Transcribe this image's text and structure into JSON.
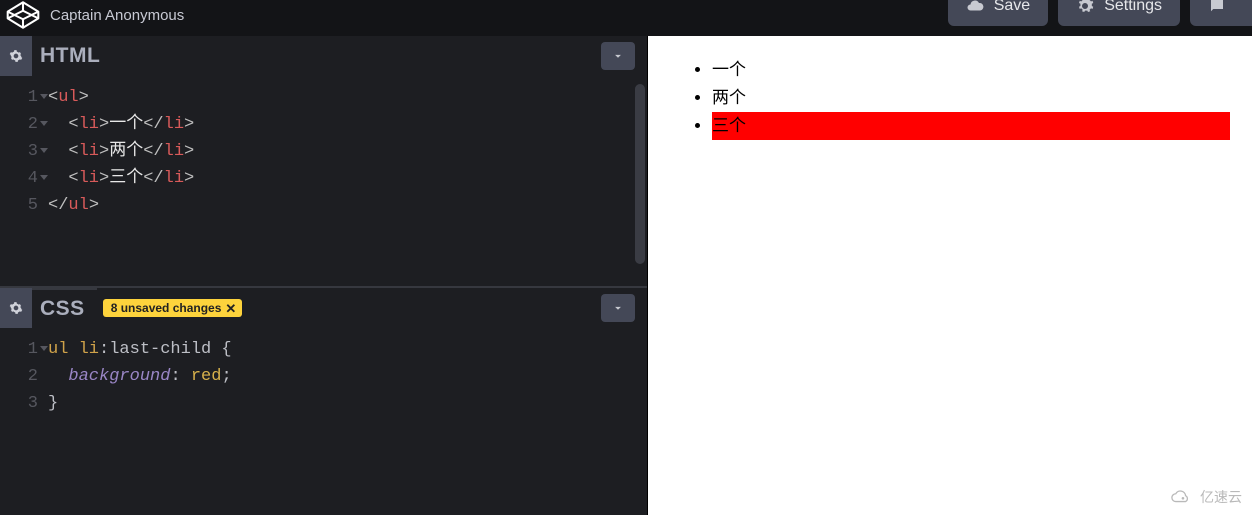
{
  "header": {
    "username": "Captain Anonymous",
    "buttons": {
      "save": "Save",
      "settings": "Settings"
    }
  },
  "panels": {
    "html": {
      "title": "HTML",
      "lines": [
        "1",
        "2",
        "3",
        "4",
        "5"
      ],
      "code": {
        "l1": {
          "open": "<",
          "tag": "ul",
          "close": ">"
        },
        "l2": {
          "open": "<",
          "tag": "li",
          "close": ">",
          "text": "一个",
          "eopen": "</",
          "etag": "li",
          "eclose": ">"
        },
        "l3": {
          "open": "<",
          "tag": "li",
          "close": ">",
          "text": "两个",
          "eopen": "</",
          "etag": "li",
          "eclose": ">"
        },
        "l4": {
          "open": "<",
          "tag": "li",
          "close": ">",
          "text": "三个",
          "eopen": "</",
          "etag": "li",
          "eclose": ">"
        },
        "l5": {
          "open": "</",
          "tag": "ul",
          "close": ">"
        }
      }
    },
    "css": {
      "title": "CSS",
      "badge": "8 unsaved changes",
      "lines": [
        "1",
        "2",
        "3"
      ],
      "code": {
        "l1": {
          "sel": "ul li",
          "pseudo": ":last-child",
          "brace": " {"
        },
        "l2": {
          "prop": "background",
          "colon": ": ",
          "val": "red",
          "semi": ";"
        },
        "l3": {
          "brace": "}"
        }
      }
    }
  },
  "preview": {
    "items": [
      "一个",
      "两个",
      "三个"
    ]
  },
  "watermark": "亿速云"
}
